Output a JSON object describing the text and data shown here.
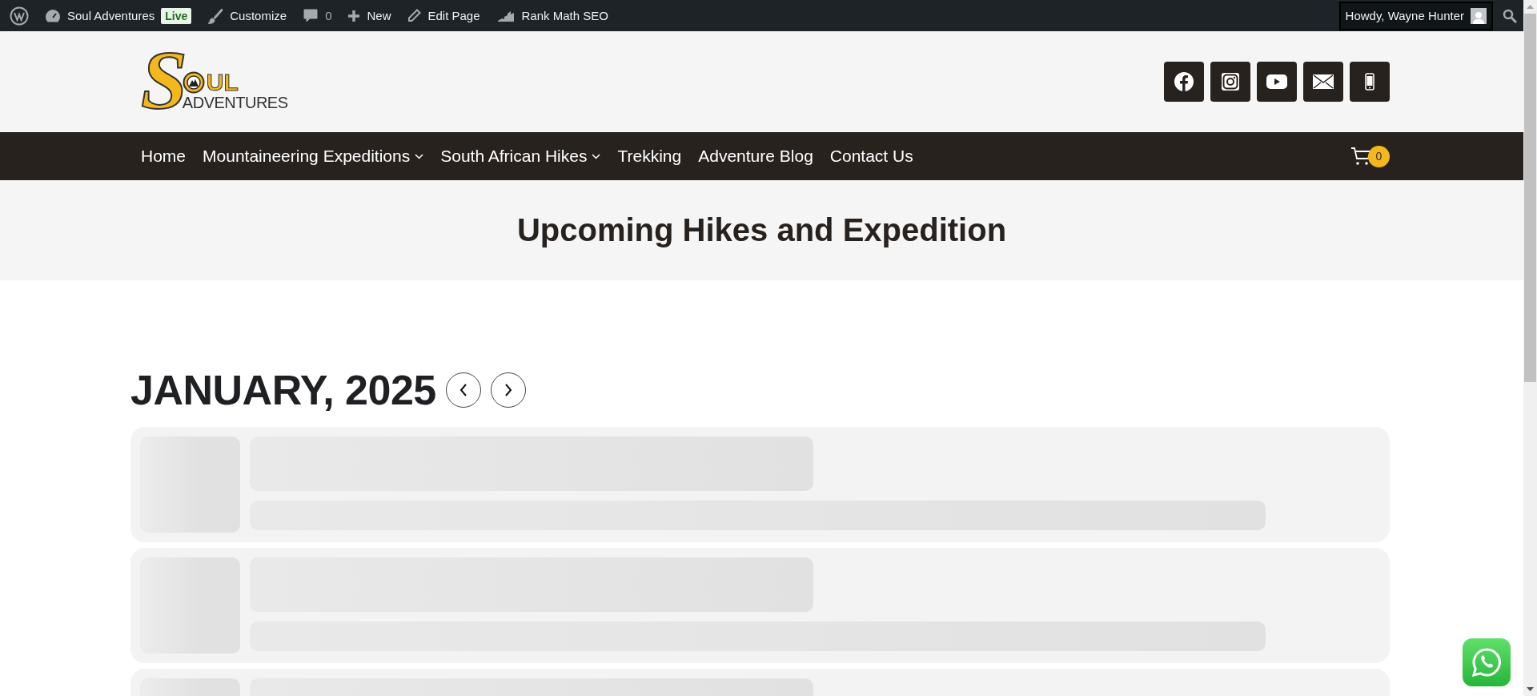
{
  "admin_bar": {
    "items": [
      {
        "kind": "wp"
      },
      {
        "kind": "site",
        "label": "Soul Adventures",
        "badge": "Live"
      },
      {
        "kind": "customize",
        "label": "Customize"
      },
      {
        "kind": "comments",
        "label": "0"
      },
      {
        "kind": "new",
        "label": "New"
      },
      {
        "kind": "edit",
        "label": "Edit Page"
      },
      {
        "kind": "seo",
        "label": "Rank Math SEO"
      }
    ],
    "account": "Howdy, Wayne Hunter"
  },
  "logo": {
    "initial": "S",
    "rest": "UL",
    "sub": "ADVENTURES"
  },
  "social": [
    {
      "kind": "facebook"
    },
    {
      "kind": "instagram"
    },
    {
      "kind": "youtube"
    },
    {
      "kind": "email"
    },
    {
      "kind": "phone"
    }
  ],
  "nav": {
    "items": [
      {
        "label": "Home",
        "has_submenu": false
      },
      {
        "label": "Mountaineering Expeditions",
        "has_submenu": true
      },
      {
        "label": "South African Hikes",
        "has_submenu": true
      },
      {
        "label": "Trekking",
        "has_submenu": false
      },
      {
        "label": "Adventure Blog",
        "has_submenu": false
      },
      {
        "label": "Contact Us",
        "has_submenu": false
      }
    ],
    "cart_count": "0"
  },
  "page_title": "Upcoming Hikes and Expedition",
  "calendar": {
    "month": "JANUARY, 2025",
    "events": [
      {
        "kind": "placeholder"
      },
      {
        "kind": "placeholder"
      },
      {
        "kind": "placeholder_top"
      }
    ]
  }
}
